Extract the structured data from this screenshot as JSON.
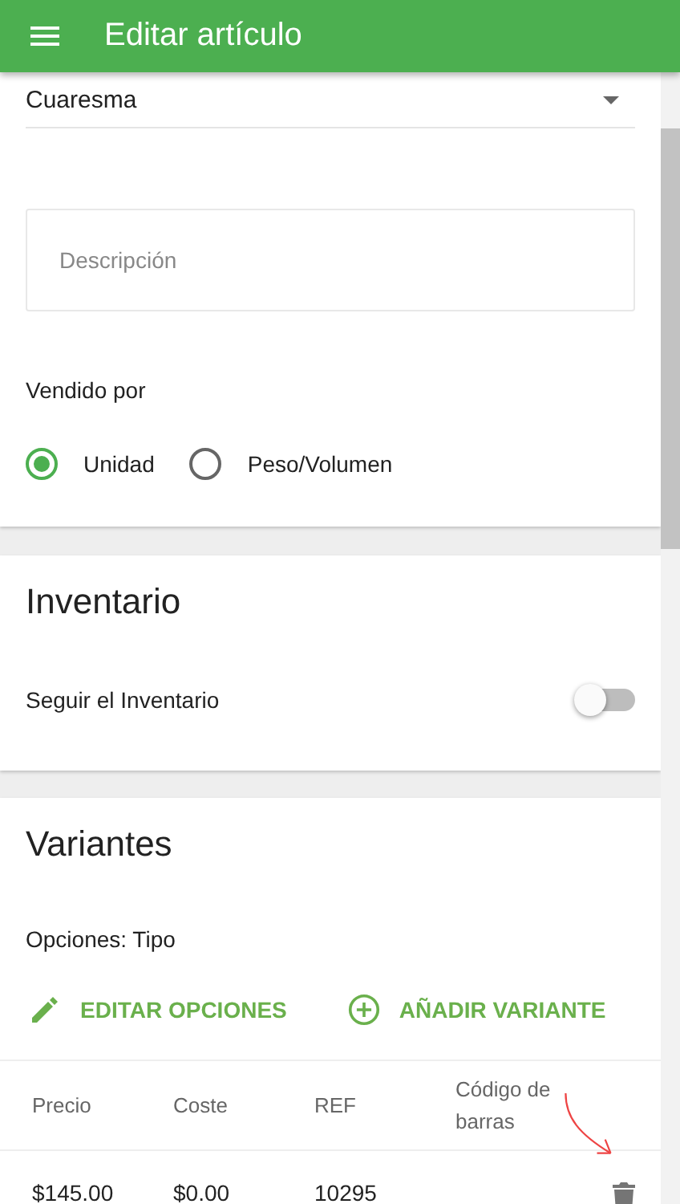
{
  "app_bar": {
    "title": "Editar artículo"
  },
  "details": {
    "category": "Cuaresma",
    "description": {
      "placeholder": "Descripción"
    },
    "sold_by_label": "Vendido por",
    "sold_by": [
      {
        "label": "Unidad",
        "selected": true
      },
      {
        "label": "Peso/Volumen",
        "selected": false
      }
    ]
  },
  "inventory": {
    "title": "Inventario",
    "track_label": "Seguir el Inventario",
    "track_on": false
  },
  "variants": {
    "title": "Variantes",
    "options_label": "Opciones: Tipo",
    "actions": [
      {
        "kind": "edit",
        "label": "EDITAR OPCIONES"
      },
      {
        "kind": "add",
        "label": "AÑADIR VARIANTE"
      }
    ],
    "table": {
      "columns": [
        "Precio",
        "Coste",
        "REF",
        "Código de barras"
      ],
      "rows": [
        {
          "price": "$145.00",
          "cost": "$0.00",
          "ref": "10295"
        }
      ]
    }
  }
}
